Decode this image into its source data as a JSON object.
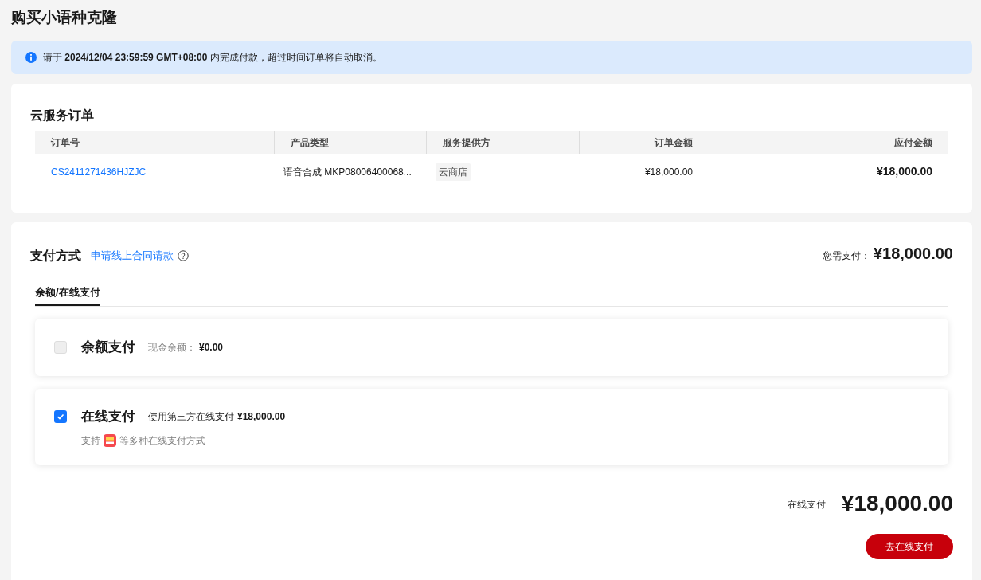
{
  "page_title": "购买小语种克隆",
  "notice": "请于 **2024/12/04 23:59:59 GMT+08:00** 内完成付款，超过时间订单将自动取消。",
  "order": {
    "title": "云服务订单",
    "columns": [
      "订单号",
      "产品类型",
      "服务提供方",
      "订单金额",
      "应付金额"
    ],
    "rows": [
      {
        "order_no": "CS2411271436HJZJC",
        "product": "语音合成 MKP08006400068...",
        "provider": "云商店",
        "amount": "¥18,000.00",
        "payable": "¥18,000.00"
      }
    ]
  },
  "payment": {
    "title": "支付方式",
    "contract_link": "申请线上合同请款",
    "need_label": "您需支付：",
    "need_amount": "¥18,000.00",
    "tabs": [
      {
        "label": "余额/在线支付",
        "selected": true
      }
    ],
    "options": [
      {
        "name": "余额支付",
        "checked": false,
        "disabled": true,
        "detail_label": "现金余额：",
        "detail_amount": "¥0.00"
      },
      {
        "name": "在线支付",
        "checked": true,
        "disabled": false,
        "detail_label": "使用第三方在线支付",
        "detail_amount": "¥18,000.00",
        "support_prefix": "支持",
        "support_suffix": "等多种在线支付方式"
      }
    ],
    "total_label": "在线支付",
    "total_amount": "¥18,000.00",
    "pay_button": "去在线支付"
  }
}
